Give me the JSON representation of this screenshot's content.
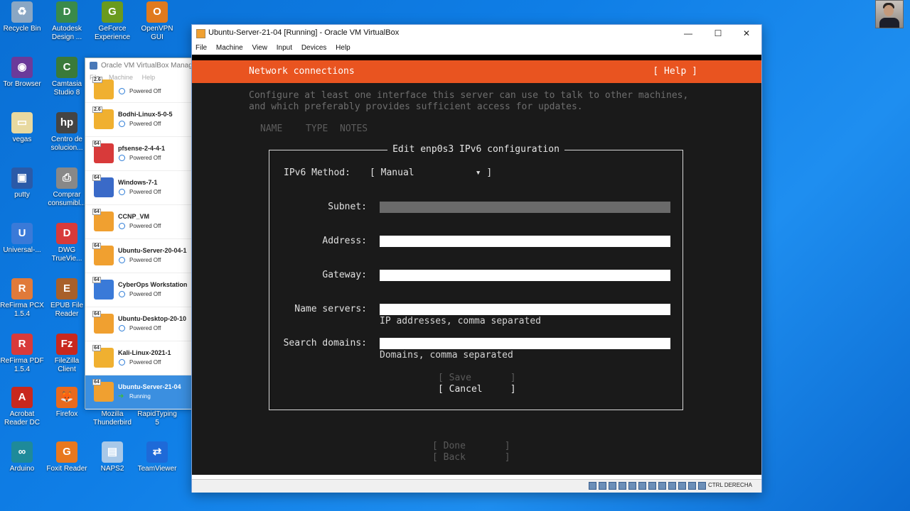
{
  "desktop": {
    "icons": [
      {
        "label": "Recycle Bin",
        "icon": "recycle-bin-icon",
        "color": "#8aa7c4",
        "glyph": "♻"
      },
      {
        "label": "Autodesk Design ...",
        "icon": "autodesk-icon",
        "color": "#3a8a4a",
        "glyph": "D"
      },
      {
        "label": "GeForce Experience",
        "icon": "geforce-icon",
        "color": "#6a9a1e",
        "glyph": "G"
      },
      {
        "label": "OpenVPN GUI",
        "icon": "openvpn-icon",
        "color": "#e07a1e",
        "glyph": "O"
      },
      {
        "label": "Tor Browser",
        "icon": "tor-browser-icon",
        "color": "#6b3a9a",
        "glyph": "◉"
      },
      {
        "label": "Camtasia Studio 8",
        "icon": "camtasia-icon",
        "color": "#3a7a3a",
        "glyph": "C"
      },
      {
        "label": "vegas",
        "icon": "vegas-icon",
        "color": "#e8d9a0",
        "glyph": "▭"
      },
      {
        "label": "Centro de solucion...",
        "icon": "hp-icon",
        "color": "#444",
        "glyph": "hp"
      },
      {
        "label": "putty",
        "icon": "putty-icon",
        "color": "#2a5aa8",
        "glyph": "▣"
      },
      {
        "label": "Comprar consumibl...",
        "icon": "printer-icon",
        "color": "#888",
        "glyph": "⎙"
      },
      {
        "label": "Universal-...",
        "icon": "universal-icon",
        "color": "#3a7ad8",
        "glyph": "U"
      },
      {
        "label": "DWG TrueVie...",
        "icon": "dwg-trueview-icon",
        "color": "#d83a3a",
        "glyph": "D"
      },
      {
        "label": "ReFirma PCX 1.5.4",
        "icon": "refirma-pcx-icon",
        "color": "#e07a3a",
        "glyph": "R"
      },
      {
        "label": "EPUB File Reader",
        "icon": "epub-reader-icon",
        "color": "#a8602a",
        "glyph": "E"
      },
      {
        "label": "ReFirma PDF 1.5.4",
        "icon": "refirma-pdf-icon",
        "color": "#d83a3a",
        "glyph": "R"
      },
      {
        "label": "FileZilla Client",
        "icon": "filezilla-icon",
        "color": "#c8281e",
        "glyph": "Fz"
      },
      {
        "label": "Acrobat Reader DC",
        "icon": "acrobat-icon",
        "color": "#c8281e",
        "glyph": "A"
      },
      {
        "label": "Firefox",
        "icon": "firefox-icon",
        "color": "#e86a1e",
        "glyph": "🦊"
      },
      {
        "label": "Mozilla Thunderbird",
        "icon": "thunderbird-icon",
        "color": "#2a6ad8",
        "glyph": "T"
      },
      {
        "label": "RapidTyping 5",
        "icon": "rapidtyping-icon",
        "color": "#3a8ad8",
        "glyph": "R"
      },
      {
        "label": "Arduino",
        "icon": "arduino-icon",
        "color": "#1e8a9a",
        "glyph": "∞"
      },
      {
        "label": "Foxit Reader",
        "icon": "foxit-icon",
        "color": "#e8781e",
        "glyph": "G"
      },
      {
        "label": "NAPS2",
        "icon": "naps2-icon",
        "color": "#a8c8e8",
        "glyph": "▤"
      },
      {
        "label": "TeamViewer",
        "icon": "teamviewer-icon",
        "color": "#1e6ad8",
        "glyph": "⇄"
      }
    ]
  },
  "manager": {
    "title": "Oracle VM VirtualBox Manag",
    "menu": [
      "File",
      "Machine",
      "Help"
    ],
    "vms": [
      {
        "name": "",
        "state": "Powered Off",
        "color": "#f0b030",
        "badge": "2.6"
      },
      {
        "name": "Bodhi-Linux-5-0-5",
        "state": "Powered Off",
        "color": "#f0b030",
        "badge": "2.6"
      },
      {
        "name": "pfsense-2-4-4-1",
        "state": "Powered Off",
        "color": "#d83a3a",
        "badge": "64"
      },
      {
        "name": "Windows-7-1",
        "state": "Powered Off",
        "color": "#3a6ac8",
        "badge": "64"
      },
      {
        "name": "CCNP_VM",
        "state": "Powered Off",
        "color": "#f0a030",
        "badge": "64"
      },
      {
        "name": "Ubuntu-Server-20-04-1",
        "state": "Powered Off",
        "color": "#f0a030",
        "badge": "64"
      },
      {
        "name": "CyberOps Workstation",
        "state": "Powered Off",
        "color": "#3a7ad8",
        "badge": "64"
      },
      {
        "name": "Ubuntu-Desktop-20-10",
        "state": "Powered Off",
        "color": "#f0a030",
        "badge": "64"
      },
      {
        "name": "Kali-Linux-2021-1",
        "state": "Powered Off",
        "color": "#f0b030",
        "badge": "64"
      },
      {
        "name": "Ubuntu-Server-21-04",
        "state": "Running",
        "color": "#f0a030",
        "badge": "64"
      }
    ]
  },
  "window": {
    "title": "Ubuntu-Server-21-04 [Running] - Oracle VM VirtualBox",
    "minimize": "—",
    "maximize": "☐",
    "close": "✕",
    "menu": [
      "File",
      "Machine",
      "View",
      "Input",
      "Devices",
      "Help"
    ],
    "host_key": "CTRL DERECHA"
  },
  "installer": {
    "header_title": "Network connections",
    "help": "[ Help ]",
    "intro": "Configure at least one interface this server can use to talk to other machines,\nand which preferably provides sufficient access for updates.",
    "columns": [
      "NAME",
      "TYPE",
      "NOTES"
    ],
    "dialog": {
      "title": "Edit enp0s3 IPv6 configuration",
      "method_label": "IPv6 Method:",
      "method_value": "[ Manual           ▾ ]",
      "subnet_label": "Subnet:",
      "address_label": "Address:",
      "gateway_label": "Gateway:",
      "nameservers_label": "Name servers:",
      "nameservers_hint": "IP addresses, comma separated",
      "searchdomains_label": "Search domains:",
      "searchdomains_hint": "Domains, comma separated",
      "save": "[ Save       ]",
      "cancel": "[ Cancel     ]"
    },
    "done": "[ Done       ]",
    "back": "[ Back       ]"
  }
}
